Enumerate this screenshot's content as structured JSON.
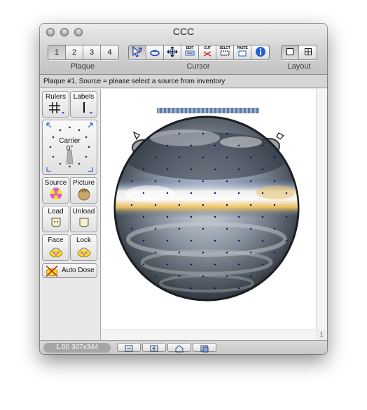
{
  "window": {
    "title": "CCC"
  },
  "toolbar": {
    "plaque": {
      "label": "Plaque",
      "buttons": [
        "1",
        "2",
        "3",
        "4"
      ],
      "selected": "1"
    },
    "cursor": {
      "label": "Cursor",
      "tools": [
        {
          "name": "select-arrow",
          "icon": "arrow-select-icon"
        },
        {
          "name": "hand",
          "icon": "hand-icon"
        },
        {
          "name": "move",
          "icon": "move-arrows-icon"
        },
        {
          "name": "edit",
          "icon": "edit-icon",
          "text": "EDIT"
        },
        {
          "name": "cut",
          "icon": "cut-icon",
          "text": "CUT"
        },
        {
          "name": "select",
          "icon": "select-icon",
          "text": "SELCT"
        },
        {
          "name": "paste",
          "icon": "paste-icon",
          "text": "PASTE"
        },
        {
          "name": "info",
          "icon": "info-icon"
        }
      ]
    },
    "layout": {
      "label": "Layout",
      "buttons": [
        "single-view",
        "grid-view"
      ],
      "selected": "single-view"
    }
  },
  "status": "Plaque #1, Source = please select a source from inventory",
  "sidebar": {
    "rulers": "Rulers",
    "labels": "Labels",
    "carrier_label": "Carrier",
    "carrier_angle": "0°",
    "source": "Source",
    "picture": "Picture",
    "load": "Load",
    "unload": "Unload",
    "face": "Face",
    "lock": "Lock",
    "auto_dose": "Auto Dose"
  },
  "canvas": {
    "page_indicator": "1"
  },
  "bottombar": {
    "zoom_info": "1.00 307x344"
  },
  "colors": {
    "accent_blue": "#2060d8",
    "source_pink": "#e05ad0",
    "source_yellow": "#f2e31b",
    "seed_dot": "#0a0a7a"
  }
}
